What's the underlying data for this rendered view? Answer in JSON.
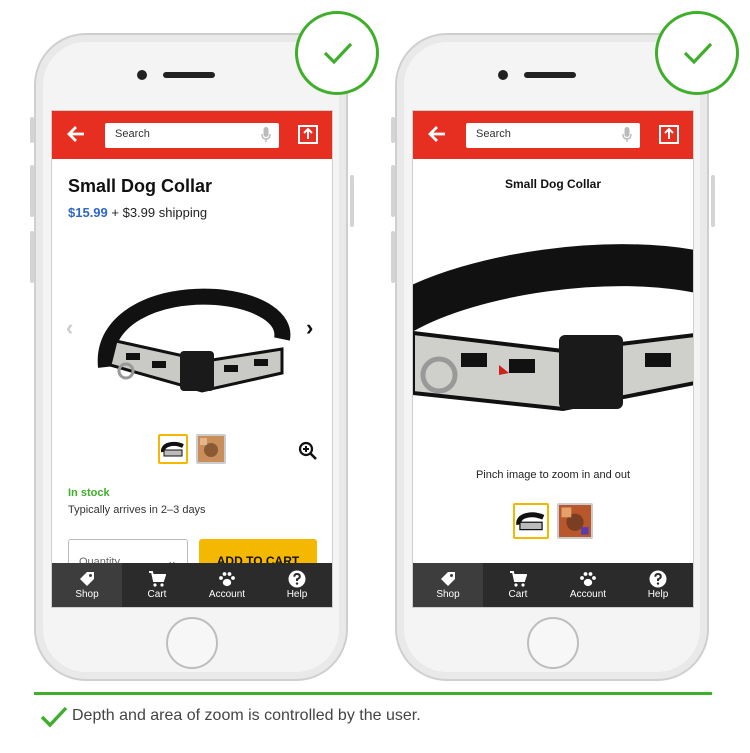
{
  "phones": [
    {
      "search_placeholder": "Search",
      "product_title": "Small Dog Collar",
      "price": "$15.99",
      "shipping": "+ $3.99 shipping",
      "stock_status": "In stock",
      "delivery": "Typically arrives in 2–3 days",
      "quantity_label": "Quantity",
      "add_to_cart_label": "ADD TO CART",
      "nav": [
        "Shop",
        "Cart",
        "Account",
        "Help"
      ]
    },
    {
      "search_placeholder": "Search",
      "product_title": "Small Dog Collar",
      "zoom_hint": "Pinch image to zoom in and out",
      "nav": [
        "Shop",
        "Cart",
        "Account",
        "Help"
      ]
    }
  ],
  "caption": "Depth and area of zoom is controlled by the user.",
  "colors": {
    "brand_red": "#e62e21",
    "price_blue": "#2f67c7",
    "success_green": "#3fae2a",
    "cta_yellow": "#f5b800",
    "nav_dark": "#2b2b2b"
  }
}
